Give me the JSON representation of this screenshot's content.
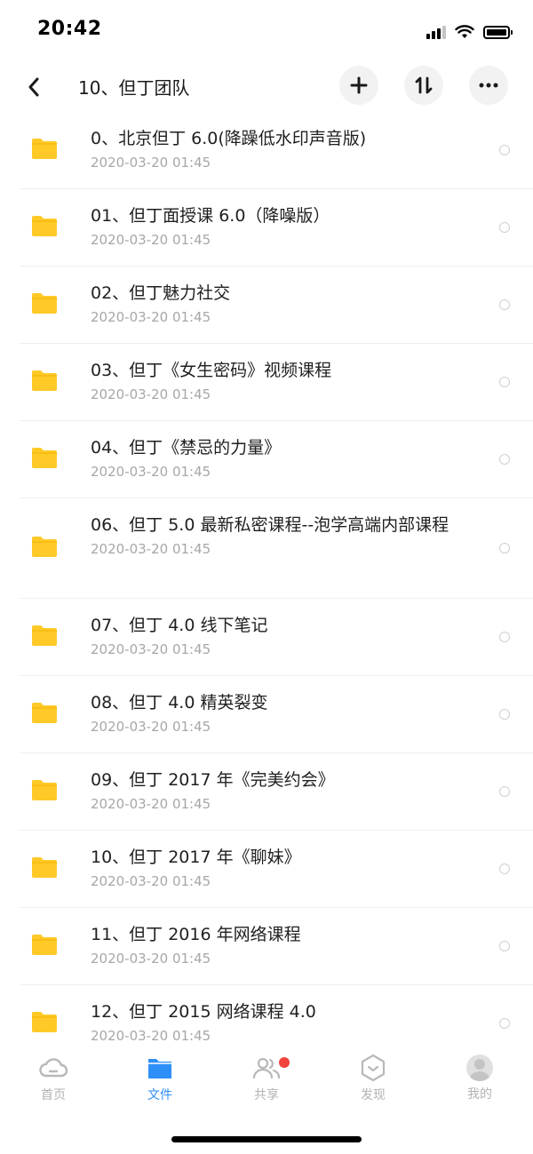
{
  "status_bar": {
    "time": "20:42"
  },
  "header": {
    "title": "10、但丁团队"
  },
  "files": [
    {
      "name": "0、北京但丁 6.0(降躁低水印声音版)",
      "date": "2020-03-20 01:45"
    },
    {
      "name": "01、但丁面授课 6.0（降噪版）",
      "date": "2020-03-20 01:45"
    },
    {
      "name": "02、但丁魅力社交",
      "date": "2020-03-20 01:45"
    },
    {
      "name": "03、但丁《女生密码》视频课程",
      "date": "2020-03-20 01:45"
    },
    {
      "name": "04、但丁《禁忌的力量》",
      "date": "2020-03-20 01:45"
    },
    {
      "name": "06、但丁 5.0 最新私密课程--泡学高端内部课程",
      "date": "2020-03-20 01:45"
    },
    {
      "name": "07、但丁 4.0 线下笔记",
      "date": "2020-03-20 01:45"
    },
    {
      "name": "08、但丁 4.0 精英裂变",
      "date": "2020-03-20 01:45"
    },
    {
      "name": "09、但丁 2017 年《完美约会》",
      "date": "2020-03-20 01:45"
    },
    {
      "name": "10、但丁 2017 年《聊妹》",
      "date": "2020-03-20 01:45"
    },
    {
      "name": "11、但丁 2016 年网络课程",
      "date": "2020-03-20 01:45"
    },
    {
      "name": "12、但丁 2015 网络课程 4.0",
      "date": "2020-03-20 01:45"
    }
  ],
  "tabs": [
    {
      "label": "首页",
      "icon": "cloud-icon",
      "active": false
    },
    {
      "label": "文件",
      "icon": "folder-icon",
      "active": true
    },
    {
      "label": "共享",
      "icon": "people-icon",
      "active": false,
      "badge": true
    },
    {
      "label": "发现",
      "icon": "discover-icon",
      "active": false
    },
    {
      "label": "我的",
      "icon": "avatar-icon",
      "active": false
    }
  ],
  "colors": {
    "accent": "#2f8ff8",
    "folder": "#ffc928",
    "badge": "#f0433c"
  }
}
